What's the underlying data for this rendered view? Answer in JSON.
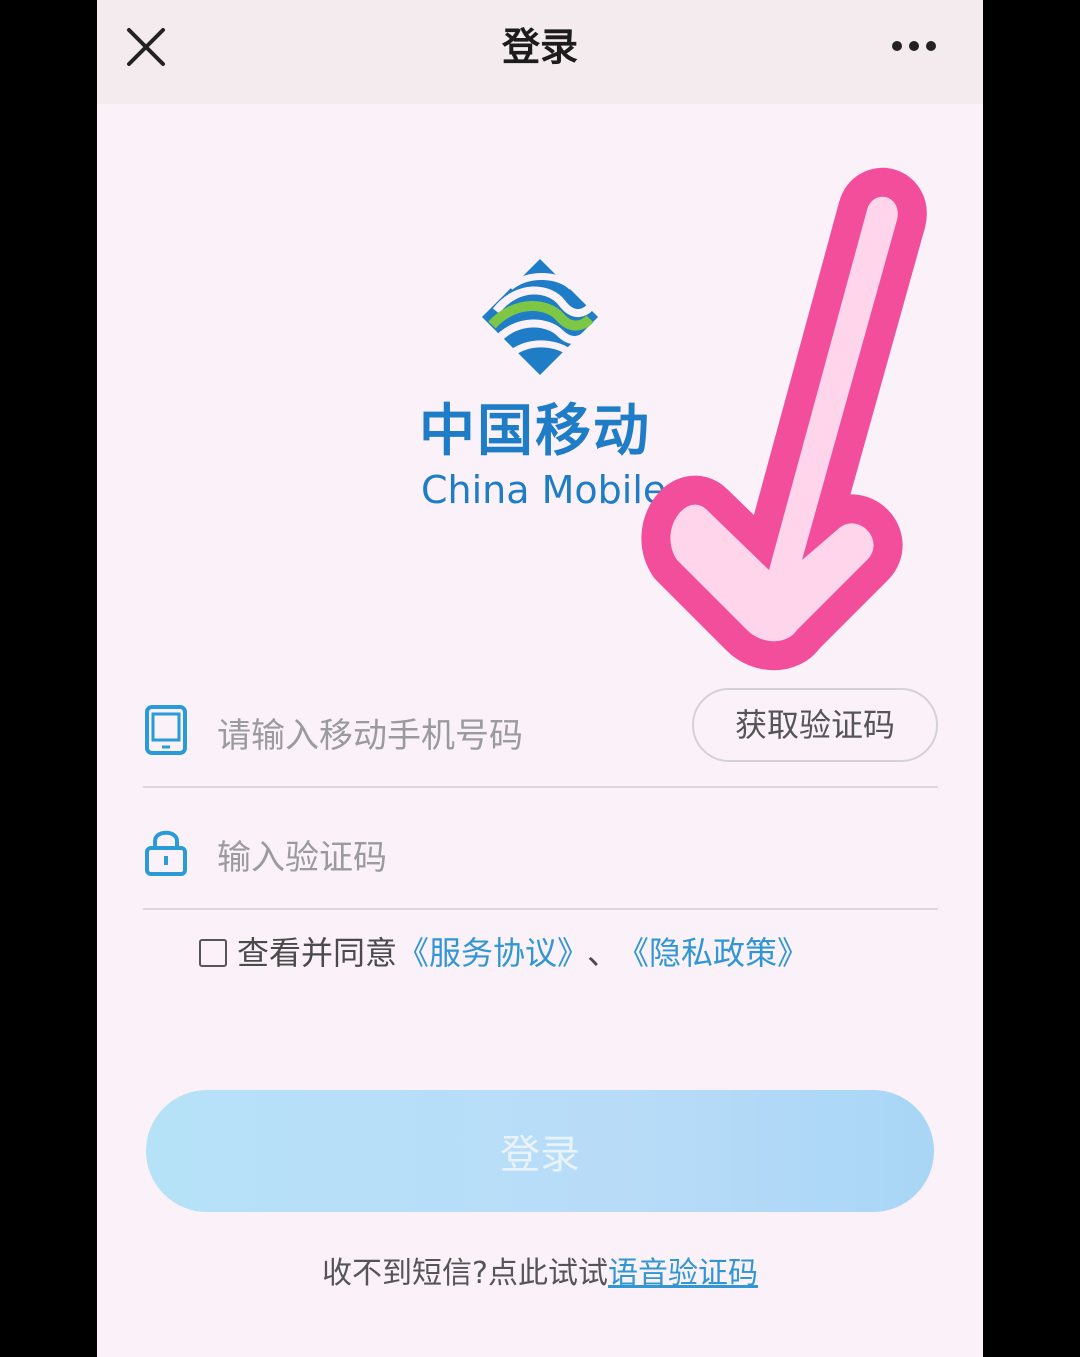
{
  "header": {
    "title": "登录",
    "close_icon": "close-icon",
    "more_icon": "more-dots-icon"
  },
  "logo": {
    "name_cn": "中国移动",
    "name_en": "China Mobile"
  },
  "phone_field": {
    "placeholder": "请输入移动手机号码",
    "icon": "phone-icon",
    "get_code_label": "获取验证码"
  },
  "code_field": {
    "placeholder": "输入验证码",
    "icon": "lock-icon"
  },
  "agreement": {
    "prefix": "查看并同意",
    "service_link": "《服务协议》",
    "separator": "、",
    "privacy_link": "《隐私政策》",
    "checked": false
  },
  "login_button": {
    "label": "登录"
  },
  "footer": {
    "prefix": "收不到短信?点此试试",
    "voice_link": "语音验证码"
  },
  "colors": {
    "link": "#3196d4",
    "login_button": "#b8dcf8",
    "arrow": "#f24e9b",
    "logo_blue": "#1e7dc6",
    "logo_green": "#7dc744"
  }
}
